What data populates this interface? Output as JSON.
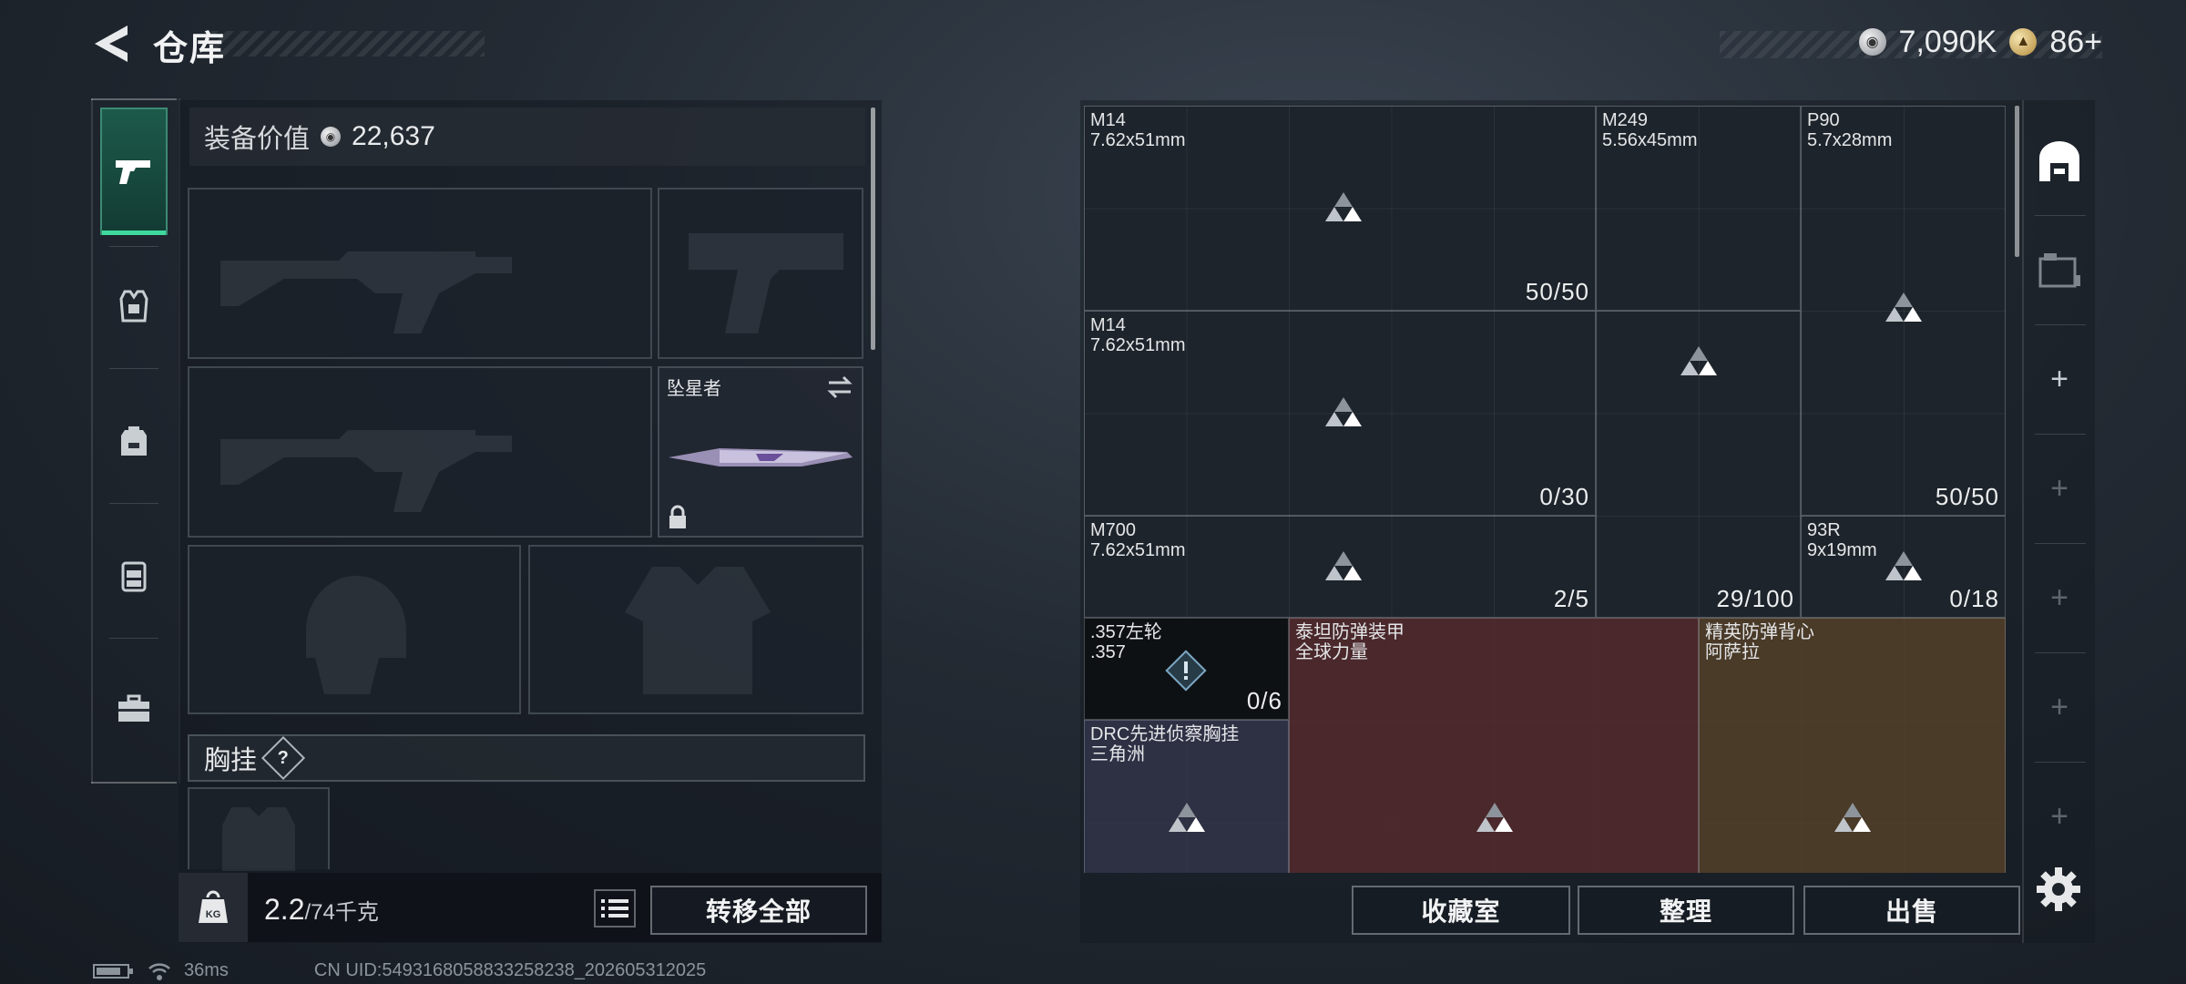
{
  "topbar": {
    "title": "仓库"
  },
  "currency": {
    "silver": "7,090K",
    "gold": "86+",
    "silver_icon": "silver-coin-icon",
    "gold_icon": "gold-coin-icon"
  },
  "loadout": {
    "equip_value_label": "装备价值",
    "equip_value": "22,637",
    "melee_name": "坠星者",
    "chest_rig_label": "胸挂",
    "help_mark": "?",
    "weight_current": "2.2",
    "weight_max": "/74千克",
    "transfer_all": "转移全部",
    "bag_label": "KG"
  },
  "stash": {
    "items": [
      {
        "name": "M14",
        "sub": "7.62x51mm",
        "count": "50/50"
      },
      {
        "name": "M249",
        "sub": "5.56x45mm",
        "count": ""
      },
      {
        "name": "P90",
        "sub": "5.7x28mm",
        "count": "50/50"
      },
      {
        "name": "M14",
        "sub": "7.62x51mm",
        "count": "0/30"
      },
      {
        "name": "M700",
        "sub": "7.62x51mm",
        "count": "2/5"
      },
      {
        "name": "",
        "sub": "",
        "count": "29/100"
      },
      {
        "name": "93R",
        "sub": "9x19mm",
        "count": "0/18"
      },
      {
        "name": ".357左轮",
        "sub": ".357",
        "count": "0/6"
      },
      {
        "name": "泰坦防弹装甲",
        "sub": "全球力量",
        "count": ""
      },
      {
        "name": "精英防弹背心",
        "sub": "阿萨拉",
        "count": ""
      },
      {
        "name": "DRC先进侦察胸挂",
        "sub": "三角洲",
        "count": ""
      }
    ],
    "buttons": {
      "collection": "收藏室",
      "sort": "整理",
      "sell": "出售"
    }
  },
  "status": {
    "ping": "36ms",
    "uid": "CN UID:5493168058833258238_202605312025"
  },
  "colors": {
    "accent_green": "#3fd99e",
    "armor_red": "#5a2a2c",
    "vest_brown": "#5a4228",
    "rig_purple": "#34344e"
  }
}
